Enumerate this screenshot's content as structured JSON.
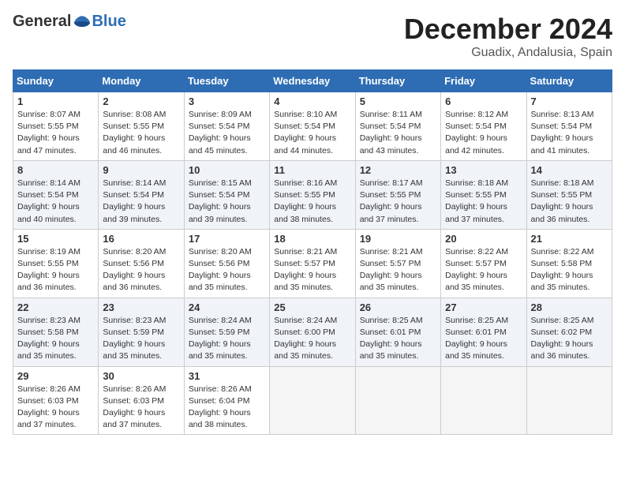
{
  "logo": {
    "general": "General",
    "blue": "Blue"
  },
  "title": "December 2024",
  "location": "Guadix, Andalusia, Spain",
  "columns": [
    "Sunday",
    "Monday",
    "Tuesday",
    "Wednesday",
    "Thursday",
    "Friday",
    "Saturday"
  ],
  "weeks": [
    [
      {
        "day": "1",
        "sunrise": "Sunrise: 8:07 AM",
        "sunset": "Sunset: 5:55 PM",
        "daylight": "Daylight: 9 hours and 47 minutes."
      },
      {
        "day": "2",
        "sunrise": "Sunrise: 8:08 AM",
        "sunset": "Sunset: 5:55 PM",
        "daylight": "Daylight: 9 hours and 46 minutes."
      },
      {
        "day": "3",
        "sunrise": "Sunrise: 8:09 AM",
        "sunset": "Sunset: 5:54 PM",
        "daylight": "Daylight: 9 hours and 45 minutes."
      },
      {
        "day": "4",
        "sunrise": "Sunrise: 8:10 AM",
        "sunset": "Sunset: 5:54 PM",
        "daylight": "Daylight: 9 hours and 44 minutes."
      },
      {
        "day": "5",
        "sunrise": "Sunrise: 8:11 AM",
        "sunset": "Sunset: 5:54 PM",
        "daylight": "Daylight: 9 hours and 43 minutes."
      },
      {
        "day": "6",
        "sunrise": "Sunrise: 8:12 AM",
        "sunset": "Sunset: 5:54 PM",
        "daylight": "Daylight: 9 hours and 42 minutes."
      },
      {
        "day": "7",
        "sunrise": "Sunrise: 8:13 AM",
        "sunset": "Sunset: 5:54 PM",
        "daylight": "Daylight: 9 hours and 41 minutes."
      }
    ],
    [
      {
        "day": "8",
        "sunrise": "Sunrise: 8:14 AM",
        "sunset": "Sunset: 5:54 PM",
        "daylight": "Daylight: 9 hours and 40 minutes."
      },
      {
        "day": "9",
        "sunrise": "Sunrise: 8:14 AM",
        "sunset": "Sunset: 5:54 PM",
        "daylight": "Daylight: 9 hours and 39 minutes."
      },
      {
        "day": "10",
        "sunrise": "Sunrise: 8:15 AM",
        "sunset": "Sunset: 5:54 PM",
        "daylight": "Daylight: 9 hours and 39 minutes."
      },
      {
        "day": "11",
        "sunrise": "Sunrise: 8:16 AM",
        "sunset": "Sunset: 5:55 PM",
        "daylight": "Daylight: 9 hours and 38 minutes."
      },
      {
        "day": "12",
        "sunrise": "Sunrise: 8:17 AM",
        "sunset": "Sunset: 5:55 PM",
        "daylight": "Daylight: 9 hours and 37 minutes."
      },
      {
        "day": "13",
        "sunrise": "Sunrise: 8:18 AM",
        "sunset": "Sunset: 5:55 PM",
        "daylight": "Daylight: 9 hours and 37 minutes."
      },
      {
        "day": "14",
        "sunrise": "Sunrise: 8:18 AM",
        "sunset": "Sunset: 5:55 PM",
        "daylight": "Daylight: 9 hours and 36 minutes."
      }
    ],
    [
      {
        "day": "15",
        "sunrise": "Sunrise: 8:19 AM",
        "sunset": "Sunset: 5:55 PM",
        "daylight": "Daylight: 9 hours and 36 minutes."
      },
      {
        "day": "16",
        "sunrise": "Sunrise: 8:20 AM",
        "sunset": "Sunset: 5:56 PM",
        "daylight": "Daylight: 9 hours and 36 minutes."
      },
      {
        "day": "17",
        "sunrise": "Sunrise: 8:20 AM",
        "sunset": "Sunset: 5:56 PM",
        "daylight": "Daylight: 9 hours and 35 minutes."
      },
      {
        "day": "18",
        "sunrise": "Sunrise: 8:21 AM",
        "sunset": "Sunset: 5:57 PM",
        "daylight": "Daylight: 9 hours and 35 minutes."
      },
      {
        "day": "19",
        "sunrise": "Sunrise: 8:21 AM",
        "sunset": "Sunset: 5:57 PM",
        "daylight": "Daylight: 9 hours and 35 minutes."
      },
      {
        "day": "20",
        "sunrise": "Sunrise: 8:22 AM",
        "sunset": "Sunset: 5:57 PM",
        "daylight": "Daylight: 9 hours and 35 minutes."
      },
      {
        "day": "21",
        "sunrise": "Sunrise: 8:22 AM",
        "sunset": "Sunset: 5:58 PM",
        "daylight": "Daylight: 9 hours and 35 minutes."
      }
    ],
    [
      {
        "day": "22",
        "sunrise": "Sunrise: 8:23 AM",
        "sunset": "Sunset: 5:58 PM",
        "daylight": "Daylight: 9 hours and 35 minutes."
      },
      {
        "day": "23",
        "sunrise": "Sunrise: 8:23 AM",
        "sunset": "Sunset: 5:59 PM",
        "daylight": "Daylight: 9 hours and 35 minutes."
      },
      {
        "day": "24",
        "sunrise": "Sunrise: 8:24 AM",
        "sunset": "Sunset: 5:59 PM",
        "daylight": "Daylight: 9 hours and 35 minutes."
      },
      {
        "day": "25",
        "sunrise": "Sunrise: 8:24 AM",
        "sunset": "Sunset: 6:00 PM",
        "daylight": "Daylight: 9 hours and 35 minutes."
      },
      {
        "day": "26",
        "sunrise": "Sunrise: 8:25 AM",
        "sunset": "Sunset: 6:01 PM",
        "daylight": "Daylight: 9 hours and 35 minutes."
      },
      {
        "day": "27",
        "sunrise": "Sunrise: 8:25 AM",
        "sunset": "Sunset: 6:01 PM",
        "daylight": "Daylight: 9 hours and 35 minutes."
      },
      {
        "day": "28",
        "sunrise": "Sunrise: 8:25 AM",
        "sunset": "Sunset: 6:02 PM",
        "daylight": "Daylight: 9 hours and 36 minutes."
      }
    ],
    [
      {
        "day": "29",
        "sunrise": "Sunrise: 8:26 AM",
        "sunset": "Sunset: 6:03 PM",
        "daylight": "Daylight: 9 hours and 37 minutes."
      },
      {
        "day": "30",
        "sunrise": "Sunrise: 8:26 AM",
        "sunset": "Sunset: 6:03 PM",
        "daylight": "Daylight: 9 hours and 37 minutes."
      },
      {
        "day": "31",
        "sunrise": "Sunrise: 8:26 AM",
        "sunset": "Sunset: 6:04 PM",
        "daylight": "Daylight: 9 hours and 38 minutes."
      },
      null,
      null,
      null,
      null
    ]
  ]
}
